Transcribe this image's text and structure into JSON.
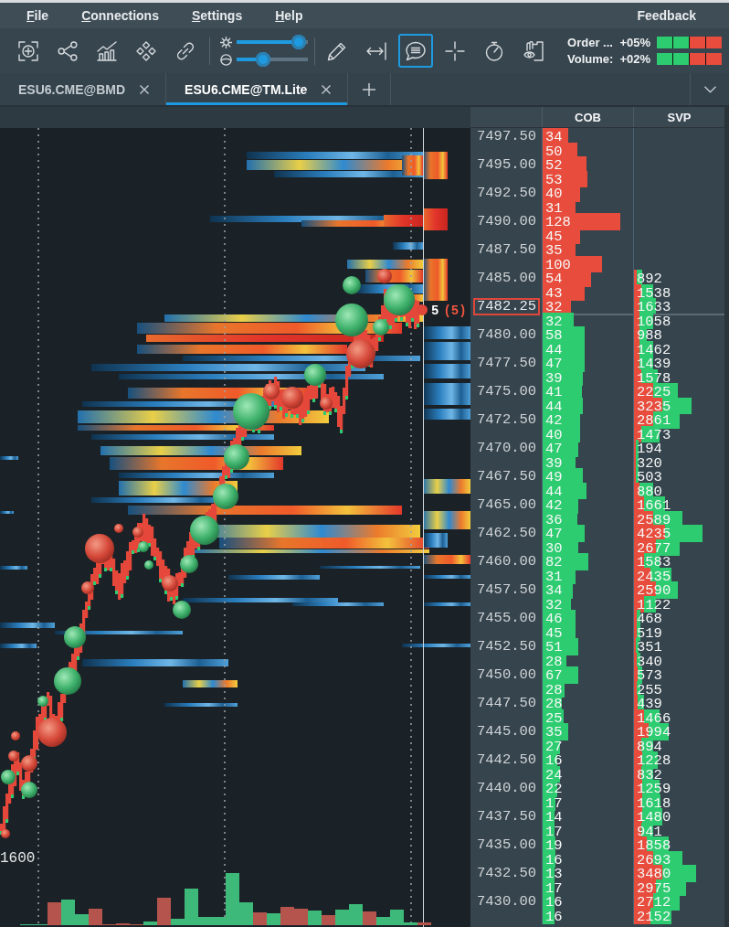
{
  "menu": [
    "File",
    "Connections",
    "Settings",
    "Help"
  ],
  "feedback": "Feedback",
  "toolbar": {
    "left_tools": [
      {
        "kind": "zoom",
        "selected": false
      },
      {
        "kind": "share",
        "selected": false
      },
      {
        "kind": "chart",
        "selected": false
      },
      {
        "kind": "pattern",
        "selected": false
      },
      {
        "kind": "link",
        "selected": false
      }
    ],
    "sliders": [
      {
        "kind": "brightness",
        "level": 0.97
      },
      {
        "kind": "contrast",
        "level": 0.34
      }
    ],
    "right_tools": [
      {
        "kind": "pencil",
        "selected": false
      },
      {
        "kind": "measure",
        "selected": false
      },
      {
        "kind": "chat",
        "selected": true
      },
      {
        "kind": "crosshair",
        "selected": false
      },
      {
        "kind": "stopwatch",
        "selected": false
      },
      {
        "kind": "eye",
        "selected": false
      }
    ],
    "indicators": [
      {
        "label": "Order ...",
        "value": "+05%",
        "cells": [
          {
            "color": "#2ecc71"
          },
          {
            "color": "#2ecc71"
          },
          {
            "color": "#e74c3c"
          },
          {
            "color": "#e74c3c"
          }
        ]
      },
      {
        "label": "Volume:",
        "value": "+02%",
        "cells": [
          {
            "color": "#2ecc71"
          },
          {
            "color": "#2ecc71"
          },
          {
            "color": "#e74c3c"
          },
          {
            "color": "#e74c3c"
          }
        ]
      }
    ]
  },
  "tabs": [
    {
      "label": "ESU6.CME@BMD",
      "selected": false
    },
    {
      "label": "ESU6.CME@TM.Lite",
      "selected": true
    }
  ],
  "chart": {
    "axis_label": "1600",
    "last_trade": {
      "size": "5",
      "total": "(5)"
    }
  },
  "ladder": {
    "columns": [
      "COB",
      "SVP"
    ],
    "rows": [
      {
        "price": "7497.50",
        "current": false,
        "cob": {
          "value": "34",
          "color": "#e74c3c",
          "level": 0.28
        }
      },
      {
        "current": false,
        "cob": {
          "value": "50",
          "color": "#e74c3c",
          "level": 0.38
        }
      },
      {
        "price": "7495.00",
        "current": false,
        "cob": {
          "value": "52",
          "color": "#e74c3c",
          "level": 0.48
        }
      },
      {
        "current": false,
        "cob": {
          "value": "53",
          "color": "#e74c3c",
          "level": 0.49
        }
      },
      {
        "price": "7492.50",
        "current": false,
        "cob": {
          "value": "40",
          "color": "#e74c3c",
          "level": 0.41
        }
      },
      {
        "current": false,
        "cob": {
          "value": "31",
          "color": "#e74c3c",
          "level": 0.36
        }
      },
      {
        "price": "7490.00",
        "current": false,
        "cob": {
          "value": "128",
          "color": "#e74c3c",
          "level": 0.86
        }
      },
      {
        "current": false,
        "cob": {
          "value": "45",
          "color": "#e74c3c",
          "level": 0.41
        }
      },
      {
        "price": "7487.50",
        "current": false,
        "cob": {
          "value": "35",
          "color": "#e74c3c",
          "level": 0.36
        }
      },
      {
        "current": false,
        "cob": {
          "value": "100",
          "color": "#e74c3c",
          "level": 0.66
        }
      },
      {
        "price": "7485.00",
        "current": false,
        "cob": {
          "value": "54",
          "color": "#e74c3c",
          "level": 0.54
        },
        "svp": {
          "value": "892",
          "total": {
            "level": 0.09
          },
          "sell": {
            "level": 0.03
          }
        }
      },
      {
        "current": false,
        "cob": {
          "value": "43",
          "color": "#e74c3c",
          "level": 0.46
        },
        "svp": {
          "value": "1538",
          "total": {
            "level": 0.21
          },
          "sell": {
            "level": 0.08
          }
        }
      },
      {
        "price": "7482.25",
        "current": true,
        "cob": {
          "value": "32",
          "color": "#e74c3c",
          "level": 0.31
        },
        "svp": {
          "value": "1633",
          "total": {
            "level": 0.24
          },
          "sell": {
            "level": 0.06
          }
        }
      },
      {
        "current": false,
        "cob": {
          "value": "32",
          "color": "#2ecc71",
          "level": 0.34
        },
        "svp": {
          "value": "1058",
          "total": {
            "level": 0.21
          },
          "sell": {
            "level": 0.06
          }
        }
      },
      {
        "price": "7480.00",
        "current": false,
        "cob": {
          "value": "58",
          "color": "#2ecc71",
          "level": 0.46
        },
        "svp": {
          "value": "988",
          "total": {
            "level": 0.14
          },
          "sell": {
            "level": 0.06
          }
        }
      },
      {
        "current": false,
        "cob": {
          "value": "44",
          "color": "#2ecc71",
          "level": 0.46
        },
        "svp": {
          "value": "1462",
          "total": {
            "level": 0.21
          },
          "sell": {
            "level": 0.06
          }
        }
      },
      {
        "price": "7477.50",
        "current": false,
        "cob": {
          "value": "47",
          "color": "#2ecc71",
          "level": 0.46
        },
        "svp": {
          "value": "1439",
          "total": {
            "level": 0.21
          },
          "sell": {
            "level": 0.06
          }
        }
      },
      {
        "current": false,
        "cob": {
          "value": "39",
          "color": "#2ecc71",
          "level": 0.44
        },
        "svp": {
          "value": "1578",
          "total": {
            "level": 0.26
          },
          "sell": {
            "level": 0.08
          }
        }
      },
      {
        "price": "7475.00",
        "current": false,
        "cob": {
          "value": "41",
          "color": "#2ecc71",
          "level": 0.43
        },
        "svp": {
          "value": "2225",
          "total": {
            "level": 0.48
          },
          "sell": {
            "level": 0.21
          }
        }
      },
      {
        "current": false,
        "cob": {
          "value": "44",
          "color": "#2ecc71",
          "level": 0.44
        },
        "svp": {
          "value": "3235",
          "total": {
            "level": 0.64
          },
          "sell": {
            "level": 0.31
          }
        }
      },
      {
        "price": "7472.50",
        "current": false,
        "cob": {
          "value": "42",
          "color": "#2ecc71",
          "level": 0.41
        },
        "svp": {
          "value": "2861",
          "total": {
            "level": 0.51
          },
          "sell": {
            "level": 0.21
          }
        }
      },
      {
        "current": false,
        "cob": {
          "value": "40",
          "color": "#2ecc71",
          "level": 0.41
        },
        "svp": {
          "value": "1473",
          "total": {
            "level": 0.28
          },
          "sell": {
            "level": 0.08
          }
        }
      },
      {
        "price": "7470.00",
        "current": false,
        "cob": {
          "value": "47",
          "color": "#2ecc71",
          "level": 0.39
        },
        "svp": {
          "value": "194",
          "total": {
            "level": 0.05
          },
          "sell": {
            "level": 0.02
          }
        }
      },
      {
        "current": false,
        "cob": {
          "value": "39",
          "color": "#2ecc71",
          "level": 0.36
        },
        "svp": {
          "value": "320",
          "total": {
            "level": 0.05
          },
          "sell": {
            "level": 0.02
          }
        }
      },
      {
        "price": "7467.50",
        "current": false,
        "cob": {
          "value": "49",
          "color": "#2ecc71",
          "level": 0.44
        },
        "svp": {
          "value": "503",
          "total": {
            "level": 0.05
          },
          "sell": {
            "level": 0.02
          }
        }
      },
      {
        "current": false,
        "cob": {
          "value": "44",
          "color": "#2ecc71",
          "level": 0.48
        },
        "svp": {
          "value": "880",
          "total": {
            "level": 0.21
          },
          "sell": {
            "level": 0.06
          }
        }
      },
      {
        "price": "7465.00",
        "current": false,
        "cob": {
          "value": "42",
          "color": "#2ecc71",
          "level": 0.39
        },
        "svp": {
          "value": "1661",
          "total": {
            "level": 0.34
          },
          "sell": {
            "level": 0.11
          }
        }
      },
      {
        "current": false,
        "cob": {
          "value": "36",
          "color": "#2ecc71",
          "level": 0.38
        },
        "svp": {
          "value": "2589",
          "total": {
            "level": 0.54
          },
          "sell": {
            "level": 0.21
          }
        }
      },
      {
        "price": "7462.50",
        "current": false,
        "cob": {
          "value": "47",
          "color": "#2ecc71",
          "level": 0.46
        },
        "svp": {
          "value": "4235",
          "total": {
            "level": 0.76
          },
          "sell": {
            "level": 0.34
          }
        }
      },
      {
        "current": false,
        "cob": {
          "value": "30",
          "color": "#2ecc71",
          "level": 0.39
        },
        "svp": {
          "value": "2677",
          "total": {
            "level": 0.51
          },
          "sell": {
            "level": 0.24
          }
        }
      },
      {
        "price": "7460.00",
        "current": false,
        "cob": {
          "value": "82",
          "color": "#2ecc71",
          "level": 0.5
        },
        "svp": {
          "value": "1583",
          "total": {
            "level": 0.28
          },
          "sell": {
            "level": 0.11
          }
        }
      },
      {
        "current": false,
        "cob": {
          "value": "31",
          "color": "#2ecc71",
          "level": 0.36
        },
        "svp": {
          "value": "2435",
          "total": {
            "level": 0.41
          },
          "sell": {
            "level": 0.18
          }
        }
      },
      {
        "price": "7457.50",
        "current": false,
        "cob": {
          "value": "34",
          "color": "#2ecc71",
          "level": 0.33
        },
        "svp": {
          "value": "2590",
          "total": {
            "level": 0.48
          },
          "sell": {
            "level": 0.24
          }
        }
      },
      {
        "current": false,
        "cob": {
          "value": "32",
          "color": "#2ecc71",
          "level": 0.31
        },
        "svp": {
          "value": "1122",
          "total": {
            "level": 0.24
          },
          "sell": {
            "level": 0.11
          }
        }
      },
      {
        "price": "7455.00",
        "current": false,
        "cob": {
          "value": "46",
          "color": "#2ecc71",
          "level": 0.36
        },
        "svp": {
          "value": "468",
          "total": {
            "level": 0.07
          },
          "sell": {
            "level": 0.03
          }
        }
      },
      {
        "current": false,
        "cob": {
          "value": "45",
          "color": "#2ecc71",
          "level": 0.36
        },
        "svp": {
          "value": "519",
          "total": {
            "level": 0.07
          },
          "sell": {
            "level": 0.03
          }
        }
      },
      {
        "price": "7452.50",
        "current": false,
        "cob": {
          "value": "51",
          "color": "#2ecc71",
          "level": 0.39
        },
        "svp": {
          "value": "351",
          "total": {
            "level": 0.05
          },
          "sell": {
            "level": 0.02
          }
        }
      },
      {
        "current": false,
        "cob": {
          "value": "28",
          "color": "#2ecc71",
          "level": 0.26
        },
        "svp": {
          "value": "340",
          "total": {
            "level": 0.07
          },
          "sell": {
            "level": 0.03
          }
        }
      },
      {
        "price": "7450.00",
        "current": false,
        "cob": {
          "value": "67",
          "color": "#2ecc71",
          "level": 0.39
        },
        "svp": {
          "value": "573",
          "total": {
            "level": 0.09
          },
          "sell": {
            "level": 0.04
          }
        }
      },
      {
        "current": false,
        "cob": {
          "value": "28",
          "color": "#2ecc71",
          "level": 0.24
        },
        "svp": {
          "value": "255",
          "total": {
            "level": 0.07
          },
          "sell": {
            "level": 0.03
          }
        }
      },
      {
        "price": "7447.50",
        "current": false,
        "cob": {
          "value": "28",
          "color": "#2ecc71",
          "level": 0.21
        },
        "svp": {
          "value": "439",
          "total": {
            "level": 0.11
          },
          "sell": {
            "level": 0.04
          }
        }
      },
      {
        "current": false,
        "cob": {
          "value": "25",
          "color": "#2ecc71",
          "level": 0.23
        },
        "svp": {
          "value": "1466",
          "total": {
            "level": 0.28
          },
          "sell": {
            "level": 0.11
          }
        }
      },
      {
        "price": "7445.00",
        "current": false,
        "cob": {
          "value": "35",
          "color": "#2ecc71",
          "level": 0.28
        },
        "svp": {
          "value": "1994",
          "total": {
            "level": 0.38
          },
          "sell": {
            "level": 0.16
          }
        }
      },
      {
        "current": false,
        "cob": {
          "value": "27",
          "color": "#2ecc71",
          "level": 0.19
        },
        "svp": {
          "value": "894",
          "total": {
            "level": 0.21
          },
          "sell": {
            "level": 0.08
          }
        }
      },
      {
        "price": "7442.50",
        "current": false,
        "cob": {
          "value": "16",
          "color": "#2ecc71",
          "level": 0.16
        },
        "svp": {
          "value": "1228",
          "total": {
            "level": 0.26
          },
          "sell": {
            "level": 0.09
          }
        }
      },
      {
        "current": false,
        "cob": {
          "value": "24",
          "color": "#2ecc71",
          "level": 0.19
        },
        "svp": {
          "value": "832",
          "total": {
            "level": 0.21
          },
          "sell": {
            "level": 0.08
          }
        }
      },
      {
        "price": "7440.00",
        "current": false,
        "cob": {
          "value": "22",
          "color": "#2ecc71",
          "level": 0.16
        },
        "svp": {
          "value": "1259",
          "total": {
            "level": 0.28
          },
          "sell": {
            "level": 0.09
          }
        }
      },
      {
        "current": false,
        "cob": {
          "value": "17",
          "color": "#2ecc71",
          "level": 0.14
        },
        "svp": {
          "value": "1618",
          "total": {
            "level": 0.29
          },
          "sell": {
            "level": 0.09
          }
        }
      },
      {
        "price": "7437.50",
        "current": false,
        "cob": {
          "value": "14",
          "color": "#2ecc71",
          "level": 0.13
        },
        "svp": {
          "value": "1480",
          "total": {
            "level": 0.31
          },
          "sell": {
            "level": 0.09
          }
        }
      },
      {
        "current": false,
        "cob": {
          "value": "17",
          "color": "#2ecc71",
          "level": 0.13
        },
        "svp": {
          "value": "941",
          "total": {
            "level": 0.21
          },
          "sell": {
            "level": 0.08
          }
        }
      },
      {
        "price": "7435.00",
        "current": false,
        "cob": {
          "value": "19",
          "color": "#2ecc71",
          "level": 0.14
        },
        "svp": {
          "value": "1858",
          "total": {
            "level": 0.38
          },
          "sell": {
            "level": 0.14
          }
        }
      },
      {
        "current": false,
        "cob": {
          "value": "16",
          "color": "#2ecc71",
          "level": 0.14
        },
        "svp": {
          "value": "2693",
          "total": {
            "level": 0.54
          },
          "sell": {
            "level": 0.21
          }
        }
      },
      {
        "price": "7432.50",
        "current": false,
        "cob": {
          "value": "13",
          "color": "#2ecc71",
          "level": 0.13
        },
        "svp": {
          "value": "3480",
          "total": {
            "level": 0.69
          },
          "sell": {
            "level": 0.31
          }
        }
      },
      {
        "current": false,
        "cob": {
          "value": "17",
          "color": "#2ecc71",
          "level": 0.13
        },
        "svp": {
          "value": "2975",
          "total": {
            "level": 0.58
          },
          "sell": {
            "level": 0.24
          }
        }
      },
      {
        "price": "7430.00",
        "current": false,
        "cob": {
          "value": "16",
          "color": "#2ecc71",
          "level": 0.13
        },
        "svp": {
          "value": "2712",
          "total": {
            "level": 0.51
          },
          "sell": {
            "level": 0.21
          }
        }
      },
      {
        "current": false,
        "cob": {
          "value": "16",
          "color": "#2ecc71",
          "level": 0.13
        },
        "svp": {
          "value": "2152",
          "total": {
            "level": 0.41
          },
          "sell": {
            "level": 0.18
          }
        }
      }
    ]
  }
}
